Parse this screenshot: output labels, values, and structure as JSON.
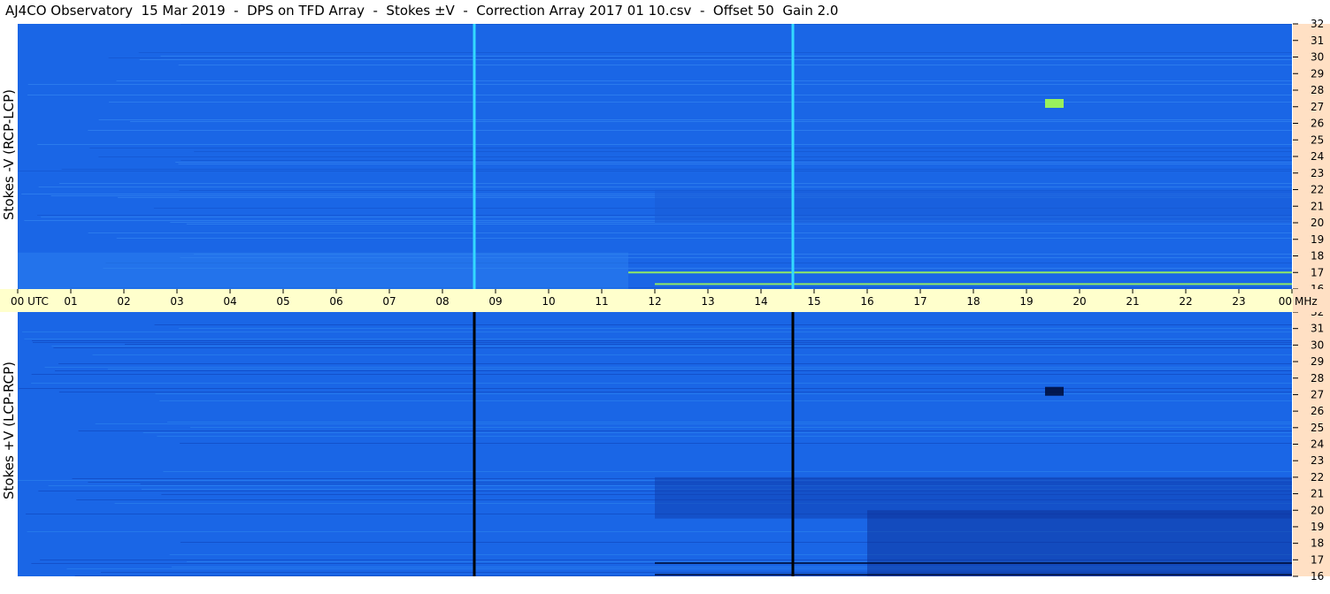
{
  "title": "AJ4CO Observatory  15 Mar 2019  -  DPS on TFD Array  -  Stokes ±V  -  Correction Array 2017 01 10.csv  -  Offset 50  Gain 2.0",
  "colors": {
    "panel_bg": "#1a66e6",
    "axis_bg": "#ffffcc",
    "scale_bg": "#ffe0c4",
    "marker_top": "#33d9ff",
    "marker_bottom": "#000000",
    "burst_top": "#a6ff4d",
    "burst_bottom": "#001040"
  },
  "chart_data": [
    {
      "type": "heatmap",
      "title": "Stokes -V (RCP-LCP)",
      "ylabel": "Stokes -V (RCP-LCP)",
      "x_ticks": [
        "00 UTC",
        "01",
        "02",
        "03",
        "04",
        "05",
        "06",
        "07",
        "08",
        "09",
        "10",
        "11",
        "12",
        "13",
        "14",
        "15",
        "16",
        "17",
        "18",
        "19",
        "20",
        "21",
        "22",
        "23",
        "00"
      ],
      "y_ticks": [
        "32",
        "31",
        "30",
        "29",
        "28",
        "27",
        "26",
        "25",
        "24",
        "23",
        "22",
        "21",
        "20",
        "19",
        "18",
        "17",
        "16"
      ],
      "xlim": [
        0,
        24
      ],
      "ylim": [
        16,
        32
      ],
      "marker_lines_utc": [
        8.6,
        14.6
      ],
      "bursts": [
        {
          "utc_start": 19.35,
          "utc_end": 19.7,
          "mhz": 27.2
        },
        {
          "utc_start": 11.5,
          "utc_end": 24.0,
          "mhz": 17.0
        },
        {
          "utc_start": 12.0,
          "utc_end": 24.0,
          "mhz": 16.3
        }
      ]
    },
    {
      "type": "heatmap",
      "title": "Stokes +V (LCP-RCP)",
      "ylabel": "Stokes +V (LCP-RCP)",
      "x_ticks": [
        "00 UTC",
        "01",
        "02",
        "03",
        "04",
        "05",
        "06",
        "07",
        "08",
        "09",
        "10",
        "11",
        "12",
        "13",
        "14",
        "15",
        "16",
        "17",
        "18",
        "19",
        "20",
        "21",
        "22",
        "23",
        "00"
      ],
      "y_ticks": [
        "32",
        "31",
        "30",
        "29",
        "28",
        "27",
        "26",
        "25",
        "24",
        "23",
        "22",
        "21",
        "20",
        "19",
        "18",
        "17",
        "16"
      ],
      "xlim": [
        0,
        24
      ],
      "ylim": [
        16,
        32
      ],
      "marker_lines_utc": [
        8.6,
        14.6
      ],
      "bursts": [
        {
          "utc_start": 19.35,
          "utc_end": 19.7,
          "mhz": 27.2
        },
        {
          "utc_start": 12.0,
          "utc_end": 24.0,
          "mhz": 16.8
        },
        {
          "utc_start": 12.0,
          "utc_end": 24.0,
          "mhz": 16.1
        }
      ]
    }
  ],
  "x_axis_unit": "MHz"
}
